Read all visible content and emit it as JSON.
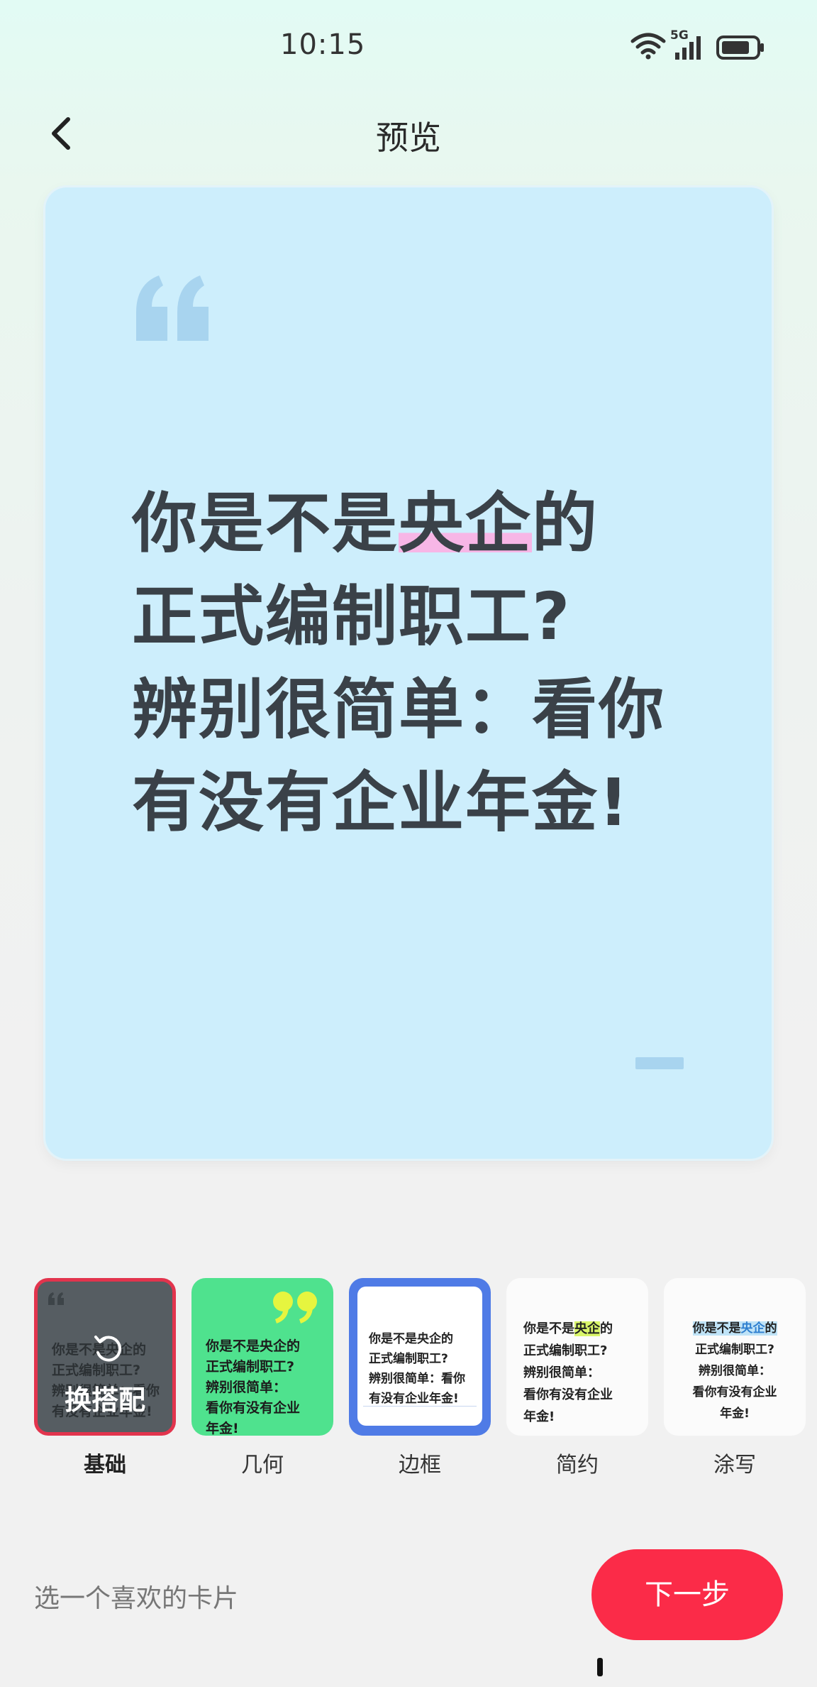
{
  "status_bar": {
    "time": "10:15",
    "wifi_icon": "wifi-icon",
    "signal_label": "5G",
    "battery_icon": "battery-icon"
  },
  "header": {
    "back_icon": "chevron-left-icon",
    "title": "预览"
  },
  "preview": {
    "background_color": "#cdeefc",
    "quote_icon": "quote-open-icon",
    "lines": [
      "你是不是",
      "央企",
      "的",
      "正式编制职工?",
      "辨别很简单：看你",
      "有没有企业年金!"
    ],
    "highlight_color": "#f7b6e6"
  },
  "templates": {
    "items": [
      {
        "label": "基础",
        "selected": true,
        "overlay_label": "换搭配",
        "overlay_icon": "refresh-icon",
        "thumb_lines": [
          "你是不是央企的",
          "正式编制职工?",
          "辨别很简单：看你",
          "有没有企业年金!"
        ]
      },
      {
        "label": "几何",
        "selected": false,
        "thumb_lines": [
          "你是不是央企的",
          "正式编制职工?",
          "辨别很简单：",
          "看你有没有企业",
          "年金!"
        ]
      },
      {
        "label": "边框",
        "selected": false,
        "thumb_lines": [
          "你是不是央企的",
          "正式编制职工?",
          "辨别很简单：看你",
          "有没有企业年金!"
        ]
      },
      {
        "label": "简约",
        "selected": false,
        "thumb_lines": [
          "你是不是",
          "央企",
          "的",
          "正式编制职工?",
          "辨别很简单：",
          "看你有没有企业",
          "年金!"
        ]
      },
      {
        "label": "涂写",
        "selected": false,
        "thumb_lines": [
          "你是不是",
          "央企",
          "的",
          "正式编制职工?",
          "辨别很简单：",
          "看你有没有企业",
          "年金!"
        ]
      }
    ]
  },
  "footer": {
    "hint": "选一个喜欢的卡片",
    "next_label": "下一步"
  },
  "colors": {
    "accent": "#fb2b48",
    "selected_border": "#e2344d"
  }
}
